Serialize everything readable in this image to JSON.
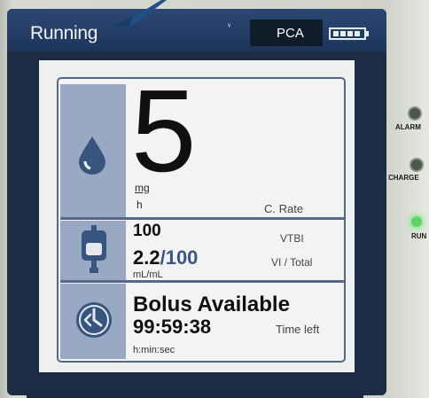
{
  "status_bar": {
    "state": "Running",
    "small_mark": "ᵛ",
    "mode": "PCA",
    "battery_icon": "battery-icon"
  },
  "rate": {
    "value": "5",
    "unit_numerator": "mg",
    "unit_denominator": "h",
    "label": "C. Rate",
    "icon": "drop-icon"
  },
  "volume": {
    "vtbi_value": "100",
    "vtbi_label": "VTBI",
    "infused": "2.2",
    "total": "/100",
    "label": "VI / Total",
    "unit": "mL/mL",
    "icon": "iv-bag-icon"
  },
  "bolus": {
    "status": "Bolus Available",
    "time_left": "99:59:38",
    "time_label": "Time left",
    "unit": "h:min:sec",
    "icon": "clock-icon"
  },
  "indicators": [
    {
      "label": "ALARM",
      "color": "#4a5a4a"
    },
    {
      "label": "CHARGE",
      "color": "#4b5a4a"
    },
    {
      "label": "RUN",
      "color": "#5fd36a"
    }
  ],
  "colors": {
    "status_bar": "#1d355a",
    "icon_panel": "#9aa9c3",
    "panel_border": "#56688a",
    "run_light": "#5fd36a"
  }
}
